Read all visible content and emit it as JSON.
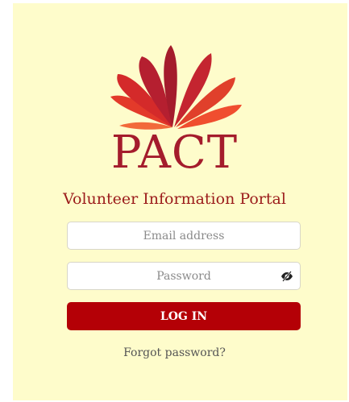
{
  "brand": {
    "logo_text": "PACT",
    "subtitle": "Volunteer Information Portal",
    "colors": {
      "background": "#fefccb",
      "primary": "#b40006",
      "logo_dark": "#a41c2c",
      "logo_red": "#d42a2a",
      "logo_orange": "#f04e2f"
    }
  },
  "form": {
    "email_placeholder": "Email address",
    "password_placeholder": "Password",
    "toggle_visibility_icon": "eye-slash-icon",
    "login_label": "LOG IN",
    "forgot_label": "Forgot password?"
  }
}
